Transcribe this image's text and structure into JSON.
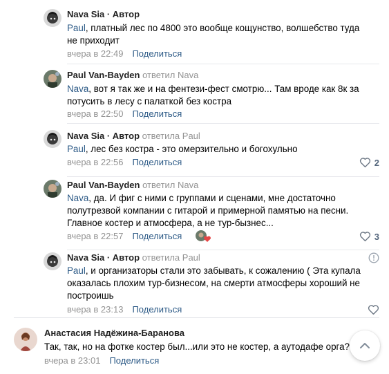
{
  "comments": [
    {
      "author": "Nava Sia",
      "author_badge": " · Автор",
      "replied_to": "",
      "mention": "Paul",
      "text": ", платный лес по 4800 это вообще кощунство, волшебство туда не приходит",
      "time": "вчера в 22:49",
      "share_label": "Поделиться",
      "likes": ""
    },
    {
      "author": "Paul Van-Bayden",
      "author_badge": "",
      "replied_to": "ответил Nava",
      "mention": "Nava",
      "text": ", вот я так же и на фентези-фест смотрю... Там вроде как 8к за потусить в лесу с палаткой без костра",
      "time": "вчера в 22:50",
      "share_label": "Поделиться",
      "likes": ""
    },
    {
      "author": "Nava Sia",
      "author_badge": " · Автор",
      "replied_to": "ответила Paul",
      "mention": "Paul",
      "text": ", лес без костра - это омерзительно и богохульно",
      "time": "вчера в 22:56",
      "share_label": "Поделиться",
      "likes": "2"
    },
    {
      "author": "Paul Van-Bayden",
      "author_badge": "",
      "replied_to": "ответил Nava",
      "mention": "Nava",
      "text": ", да. И фиг с ними с группами и сценами, мне достаточно полутрезвой компании с гитарой и примерной памятью на песни. Главное костер и атмосфера, а не тур-бызнес...",
      "time": "вчера в 22:57",
      "share_label": "Поделиться",
      "likes": "3"
    },
    {
      "author": "Nava Sia",
      "author_badge": " · Автор",
      "replied_to": "ответила Paul",
      "mention": "Paul",
      "text": ", и организаторы стали это забывать, к сожалению ( Эта купала оказалась плохим тур-бизнесом, на смерти атмосферы хороший не построишь",
      "time": "вчера в 23:13",
      "share_label": "Поделиться",
      "likes": ""
    },
    {
      "author": "Анастасия Надёжина-Баранова",
      "author_badge": "",
      "replied_to": "",
      "mention": "",
      "text": "Так, так, но на фотке костер был...или это не костер, а аутодафе орга?",
      "time": "вчера в 23:01",
      "share_label": "Поделиться",
      "likes": ""
    }
  ],
  "icons": {
    "like": "heart-outline-icon",
    "report": "info-circle-icon",
    "scroll_top": "chevron-up-icon",
    "reaction": "heart-icon"
  },
  "colors": {
    "link": "#2a5885",
    "muted": "#939393",
    "heart_reaction": "#e64646"
  }
}
